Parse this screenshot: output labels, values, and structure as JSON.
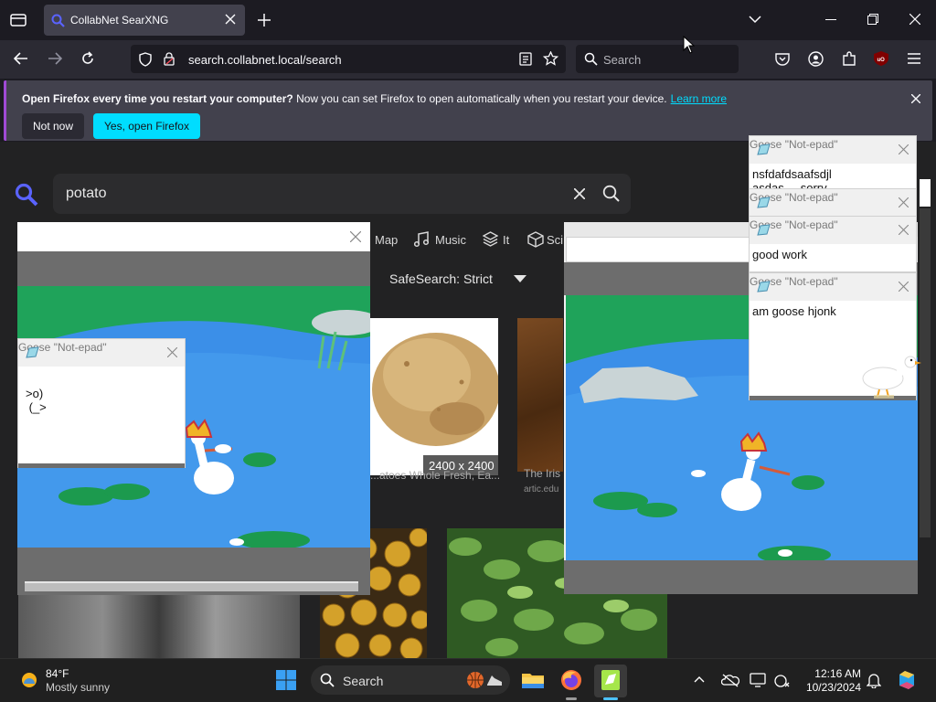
{
  "browser": {
    "tab_title": "CollabNet SearXNG",
    "url": "search.collabnet.local/search",
    "search_placeholder": "Search",
    "notification": {
      "bold": "Open Firefox every time you restart your computer?",
      "text": "Now you can set Firefox to open automatically when you restart your device.",
      "link": "Learn more",
      "not_now": "Not now",
      "yes": "Yes, open Firefox"
    }
  },
  "search": {
    "query": "potato",
    "categories": [
      "Map",
      "Music",
      "It",
      "Sci"
    ],
    "safesearch": "SafeSearch: Strict",
    "results": {
      "dimensions": "2400 x 2400",
      "caption1": "...atoes Whole Fresh, Ea...",
      "caption2": "The Iris",
      "source2": "artic.edu"
    }
  },
  "goose_notes": [
    {
      "title": "Goose \"Not-epad\"",
      "body": ">o)\n (_>"
    },
    {
      "title": "Goose \"Not-epad\"",
      "body": "nsfdafdsaafsdjl\nasdas     sorry"
    },
    {
      "title": "Goose \"Not-epad\"",
      "body": ""
    },
    {
      "title": "Goose \"Not-epad\"",
      "body": "good work"
    },
    {
      "title": "Goose \"Not-epad\"",
      "body": "am goose hjonk"
    }
  ],
  "taskbar": {
    "weather_temp": "84°F",
    "weather_desc": "Mostly sunny",
    "search_label": "Search",
    "time": "12:16 AM",
    "date": "10/23/2024"
  },
  "colors": {
    "accent": "#00ddff",
    "search_icon": "#5a63ff",
    "notification_stripe": "#a04ad5"
  }
}
